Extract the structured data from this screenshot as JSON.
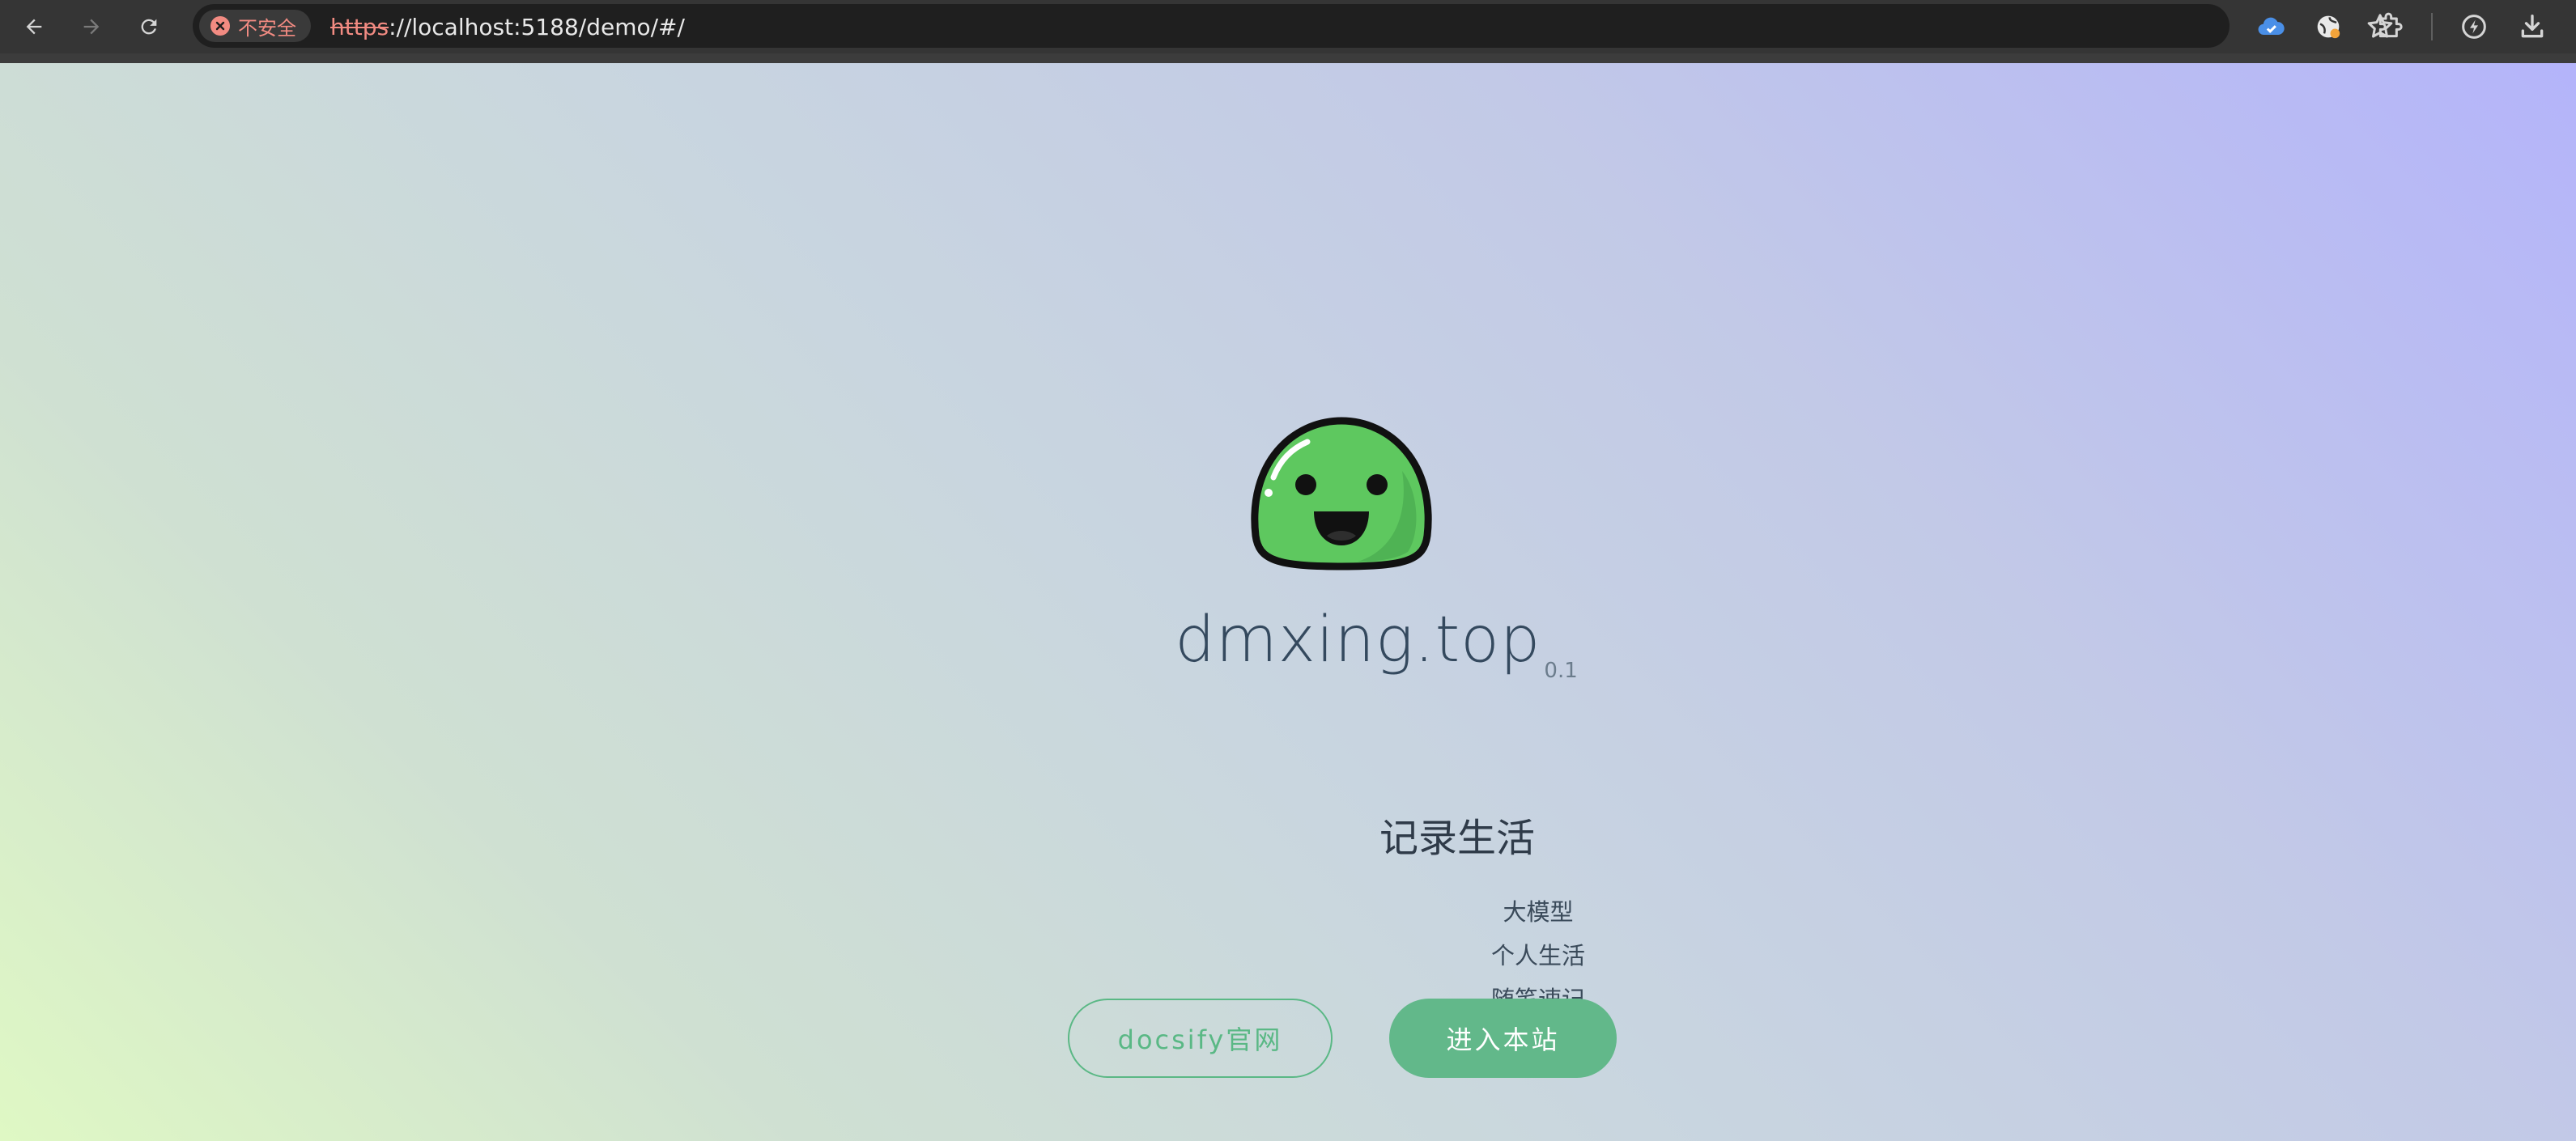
{
  "browser": {
    "security_label": "不安全",
    "url_scheme": "https",
    "url_rest": "://localhost:5188/demo/#/",
    "icons": {
      "back": "arrow-left-icon",
      "forward": "arrow-right-icon",
      "reload": "reload-icon",
      "security": "warning-circle-icon",
      "bookmark": "star-icon",
      "ext1": "cloud-extension-icon",
      "ext2": "globe-extension-icon",
      "extensions": "puzzle-icon",
      "performance": "bolt-icon",
      "downloads": "download-icon"
    }
  },
  "page": {
    "title": "dmxing.top",
    "version": "0.1",
    "tagline": "记录生活",
    "features": [
      "大模型",
      "个人生活",
      "随笔速记"
    ],
    "buttons": {
      "secondary": "docsify官网",
      "primary": "进入本站"
    },
    "colors": {
      "accent": "#62b88a",
      "text": "#34495e",
      "gradient_start": "#dff8c4",
      "gradient_end": "#b4b4fa"
    }
  }
}
